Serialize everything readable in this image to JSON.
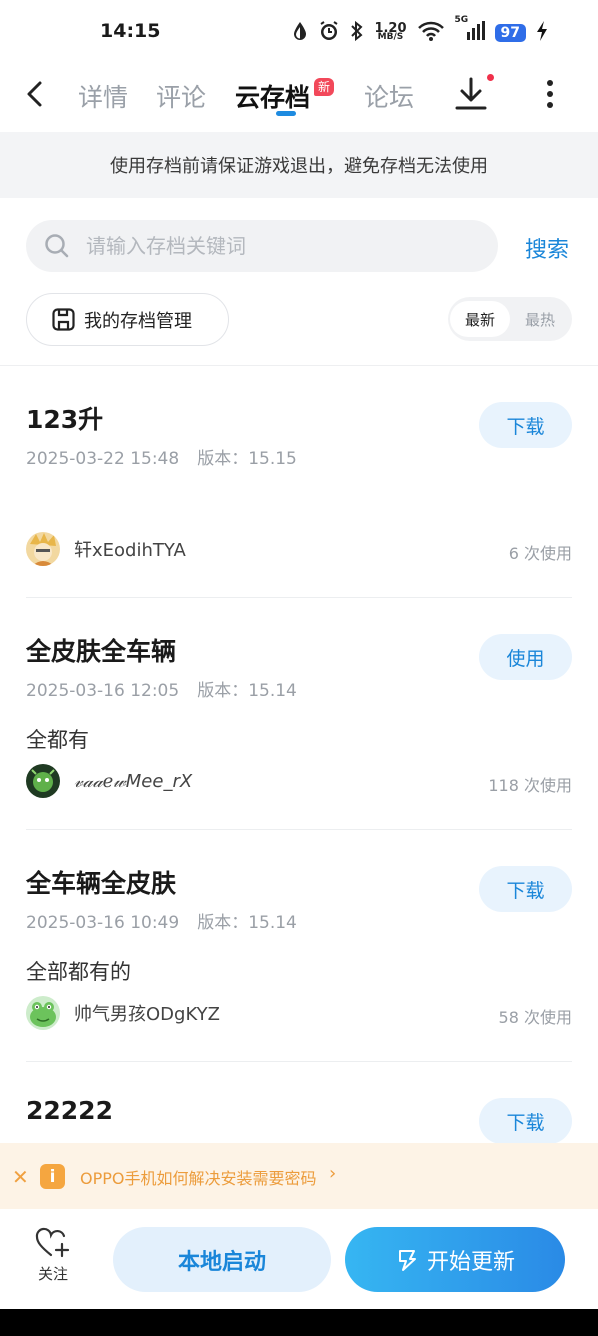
{
  "status_bar": {
    "time": "14:15",
    "speed_value": "1.20",
    "speed_unit": "MB/S",
    "network": "5G",
    "battery": "97"
  },
  "nav": {
    "tabs": [
      {
        "label": "详情"
      },
      {
        "label": "评论"
      },
      {
        "label": "云存档",
        "active": true
      },
      {
        "label": "论坛"
      }
    ],
    "new_badge": "新"
  },
  "notice": "使用存档前请保证游戏退出，避免存档无法使用",
  "search": {
    "placeholder": "请输入存档关键词",
    "button": "搜索"
  },
  "manage": {
    "label": "我的存档管理"
  },
  "sort": {
    "options": [
      "最新",
      "最热"
    ],
    "selected": "最新"
  },
  "items": [
    {
      "title": "123升",
      "date": "2025-03-22 15:48",
      "version": "版本：15.15",
      "desc": "",
      "user": "轩xEodihTYA",
      "uses": "6 次使用",
      "action": "下载"
    },
    {
      "title": "全皮肤全车辆",
      "date": "2025-03-16 12:05",
      "version": "版本：15.14",
      "desc": "全都有",
      "user": "𝓋𝒶𝒶ℯ𝓌Mee_rX",
      "uses": "118 次使用",
      "action": "使用"
    },
    {
      "title": "全车辆全皮肤",
      "date": "2025-03-16 10:49",
      "version": "版本：15.14",
      "desc": "全部都有的",
      "user": "帅气男孩ODgKYZ",
      "uses": "58 次使用",
      "action": "下载"
    },
    {
      "title": "22222",
      "date": "",
      "version": "",
      "desc": "",
      "user": "",
      "uses": "",
      "action": "下载"
    }
  ],
  "tip": {
    "text": "OPPO手机如何解决安装需要密码"
  },
  "bottom": {
    "follow_label": "关注",
    "local_launch": "本地启动",
    "start_update": "开始更新"
  },
  "colors": {
    "accent": "#1a86d9",
    "badge_red": "#f2485a",
    "tip_orange": "#ec9c3c",
    "update_gradient_start": "#36b6f2",
    "update_gradient_end": "#2a8ae6"
  },
  "icons": {
    "back": "chevron-left-icon",
    "download": "download-icon",
    "more": "more-vertical-icon",
    "search": "search-icon",
    "save": "save-icon",
    "close": "close-icon",
    "info": "info-icon",
    "heart": "heart-plus-icon",
    "update": "update-icon"
  }
}
